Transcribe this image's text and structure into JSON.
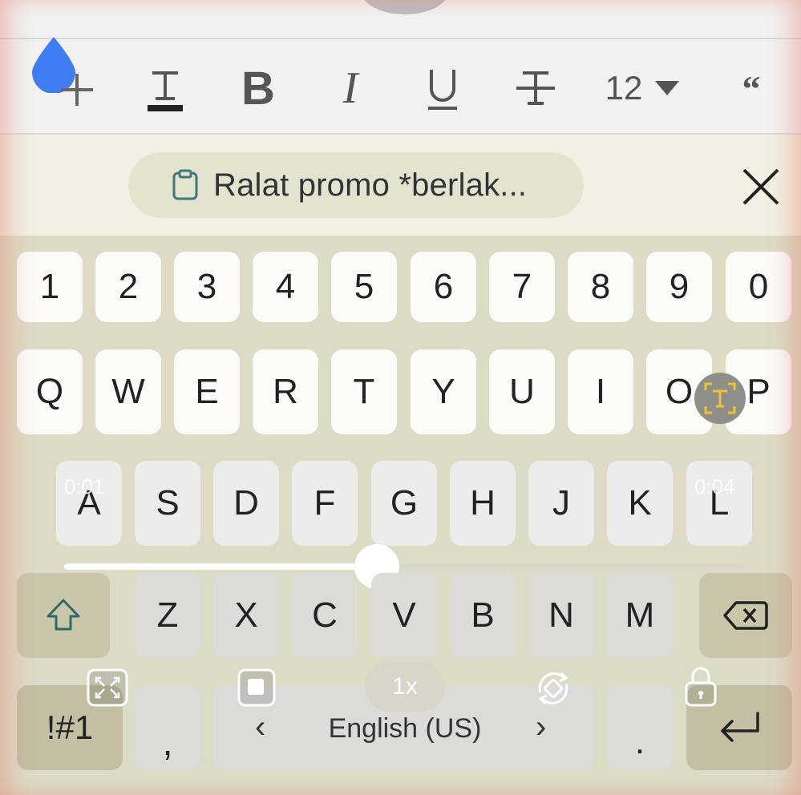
{
  "toolbar": {
    "icons": [
      "drop-add-icon",
      "text-color-icon",
      "bold-icon",
      "italic-icon",
      "underline-icon",
      "strikethrough-icon",
      "font-size-dropdown",
      "quote-icon"
    ],
    "bold_label": "B",
    "italic_label": "I",
    "underline_label": "U",
    "text_color_label": "T",
    "strike_label": "T",
    "font_size": "12",
    "quote_label": "“",
    "accent_color": "#3f7df5"
  },
  "suggestion": {
    "clipboard_text": "Ralat promo *berlak...",
    "close_icon": "close-icon"
  },
  "keyboard": {
    "row_numbers": [
      "1",
      "2",
      "3",
      "4",
      "5",
      "6",
      "7",
      "8",
      "9",
      "0"
    ],
    "row_qwerty": [
      "Q",
      "W",
      "E",
      "R",
      "T",
      "Y",
      "U",
      "I",
      "O",
      "P"
    ],
    "row_asdf": [
      "A",
      "S",
      "D",
      "F",
      "G",
      "H",
      "J",
      "K",
      "L"
    ],
    "row_zxcv": [
      "Z",
      "X",
      "C",
      "V",
      "B",
      "N",
      "M"
    ],
    "symbols_key": "!#1",
    "comma_key": ",",
    "period_key": ".",
    "language": "English (US)",
    "lang_prev": "‹",
    "lang_next": "›"
  },
  "video_overlay": {
    "time_current": "0:01",
    "time_total": "0:04",
    "progress": 0.46,
    "speed": "1x",
    "icons": [
      "fullscreen-icon",
      "picture-in-picture-icon",
      "rotate-icon",
      "lock-icon",
      "text-recognition-icon"
    ]
  }
}
